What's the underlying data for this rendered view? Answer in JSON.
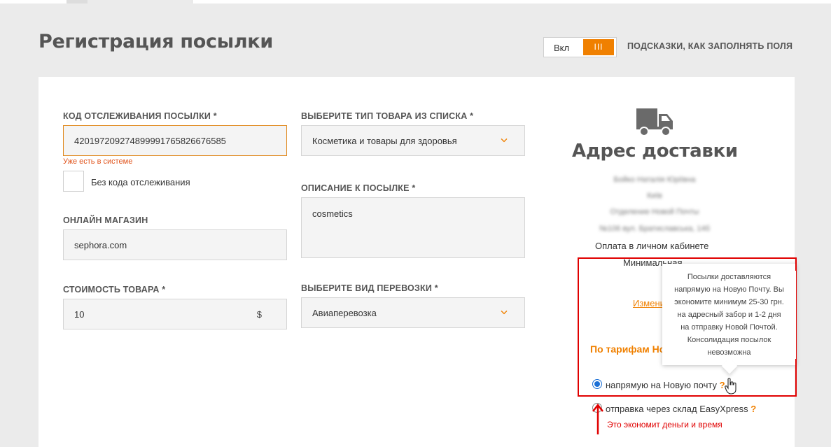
{
  "header": {
    "title": "Регистрация посылки",
    "toggle_label": "Вкл",
    "toggle_knob": "III",
    "hints_link": "ПОДСКАЗКИ, КАК ЗАПОЛНЯТЬ ПОЛЯ"
  },
  "form": {
    "tracking": {
      "label": "КОД ОТСЛЕЖИВАНИЯ ПОСЫЛКИ *",
      "value": "4201972092748999917658266765 85",
      "error": "Уже есть в системе"
    },
    "no_tracking": {
      "label": "Без кода отслеживания",
      "checked": false
    },
    "shop": {
      "label": "ОНЛАЙН МАГАЗИН",
      "value": "sephora.com"
    },
    "price": {
      "label": "СТОИМОСТЬ ТОВАРА *",
      "value": "10",
      "currency": "$"
    },
    "product_type": {
      "label": "ВЫБЕРИТЕ ТИП ТОВАРА ИЗ СПИСКА *",
      "value": "Косметика и товары для здоровья"
    },
    "description": {
      "label": "ОПИСАНИЕ К ПОСЫЛКЕ *",
      "value": "cosmetics"
    },
    "transport": {
      "label": "ВЫБЕРИТЕ ВИД ПЕРЕВОЗКИ *",
      "value": "Авиаперевозка"
    }
  },
  "address": {
    "title": "Адрес доставки",
    "blurred_lines": [
      "Бойко Наталія Юріївна",
      "Київ",
      "Отделение Новой Почты",
      "№106 вул. Братиславська, 14б"
    ],
    "payment": "Оплата в личном кабинете",
    "minimal": "Минимальная",
    "change_link": "Измени",
    "tariff": "По тарифам Но"
  },
  "delivery_options": [
    {
      "label": "напрямую на Новую почту",
      "selected": true,
      "help": "?"
    },
    {
      "label": "отправка через склад EasyXpress",
      "selected": false,
      "help": "?"
    }
  ],
  "tooltip": {
    "lines": [
      "Посылки доставляются",
      "напрямую на Новую Почту. Вы",
      "экономите минимум 25-30 грн.",
      "на адресный забор и 1-2 дня",
      "на отправку Новой Почтой.",
      "Консолидация посылок",
      "невозможна"
    ]
  },
  "annotation": {
    "text": "Это экономит деньги и время",
    "color": "#e00000"
  },
  "colors": {
    "accent": "#f08000",
    "error": "#e0531b",
    "radio": "#1a6fd6"
  }
}
